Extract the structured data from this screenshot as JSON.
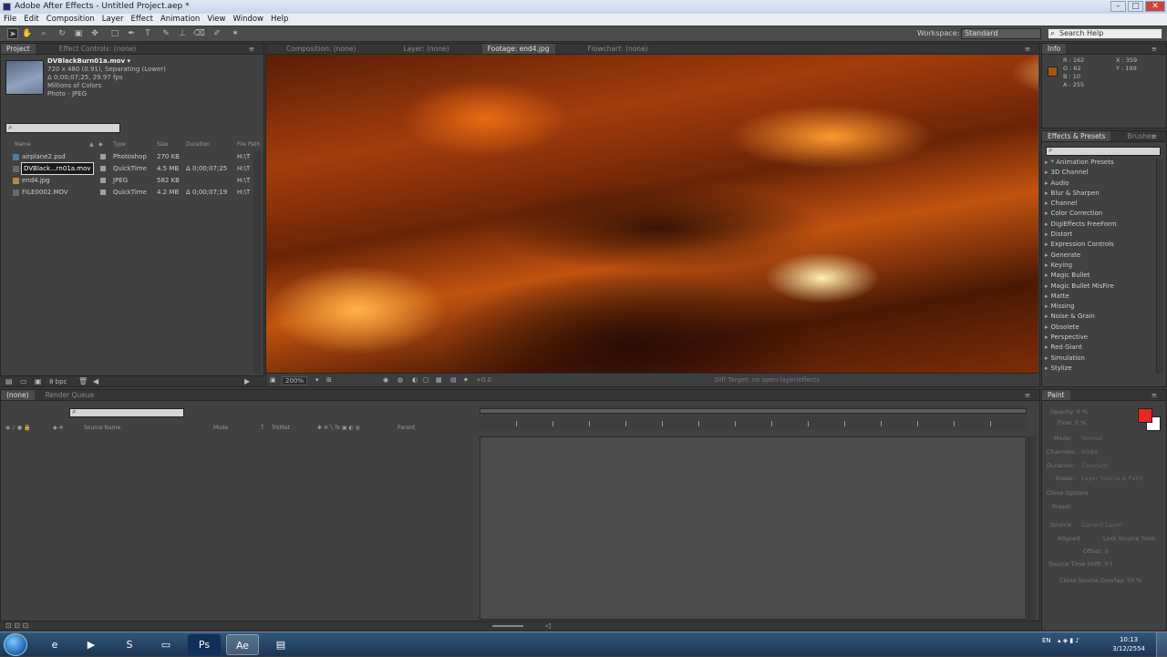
{
  "window": {
    "title": "Adobe After Effects - Untitled Project.aep *",
    "min": "–",
    "max": "□",
    "close": "✕"
  },
  "menu": [
    "File",
    "Edit",
    "Composition",
    "Layer",
    "Effect",
    "Animation",
    "View",
    "Window",
    "Help"
  ],
  "workspace": {
    "label": "Workspace:",
    "value": "Standard",
    "search_placeholder": "Search Help"
  },
  "project": {
    "tabs": [
      "Project",
      "Effect Controls: (none)"
    ],
    "preview": {
      "name": "DVBlackBurn01a.mov ▾",
      "line1": "720 x 480 (0.91), Separating (Lower)",
      "line2": "Δ 0;00;07;25, 29.97 fps",
      "line3": "Millions of Colors",
      "line4": "Photo - JPEG"
    },
    "columns": [
      "Name",
      "Type",
      "Size",
      "Duration",
      "File Path"
    ],
    "items": [
      {
        "name": "airplane2.psd",
        "type": "Photoshop",
        "size": "270 KB",
        "duration": "",
        "path": "H:\\T"
      },
      {
        "name": "DVBlack...rn01a.mov",
        "type": "QuickTime",
        "size": "4.5 MB",
        "duration": "Δ 0;00;07;25",
        "path": "H:\\T"
      },
      {
        "name": "end4.jpg",
        "type": "JPEG",
        "size": "582 KB",
        "duration": "",
        "path": "H:\\T"
      },
      {
        "name": "FILE0002.MOV",
        "type": "QuickTime",
        "size": "4.2 MB",
        "duration": "Δ 0;00;07;19",
        "path": "H:\\T"
      }
    ],
    "bpc": "8 bpc"
  },
  "viewer": {
    "tabs": [
      "Composition: (none)",
      "Layer: (none)",
      "Footage: end4.jpg",
      "Flowchart: (none)"
    ],
    "zoom": "200%",
    "offset": "+0.0",
    "status": "Diff Target: no open-layer/effects"
  },
  "info": {
    "tab": "Info",
    "r": "R : 162",
    "g": "G : 62",
    "b": "B : 10",
    "a": "A : 255",
    "x": "X : 359",
    "y": "Y : 199",
    "swatch": "#a25a10"
  },
  "effects": {
    "tabs": [
      "Effects & Presets",
      "Brushes"
    ],
    "items": [
      "* Animation Presets",
      "3D Channel",
      "Audio",
      "Blur & Sharpen",
      "Channel",
      "Color Correction",
      "DigiEffects FreeForm",
      "Distort",
      "Expression Controls",
      "Generate",
      "Keying",
      "Magic Bullet",
      "Magic Bullet MisFire",
      "Matte",
      "Missing",
      "Noise & Grain",
      "Obsolete",
      "Perspective",
      "Red Giant",
      "Simulation",
      "Stylize"
    ]
  },
  "timeline": {
    "tabs": [
      "(none)",
      "Render Queue"
    ],
    "columns": [
      "Source Name",
      "Mode",
      "T",
      "TrkMat",
      "Parent"
    ]
  },
  "paint": {
    "tab": "Paint",
    "fg": "#e8271e",
    "bg": "#ffffff",
    "labels": [
      "Opacity: 0 %",
      "Flow: 0 %",
      "Mode:",
      "Normal",
      "Channels:",
      "RGBA",
      "Duration:",
      "Constant",
      "Erase:",
      "Layer Source & Paint",
      "Clone Options",
      "Preset:",
      "Source:",
      "Current Layer",
      "Aligned",
      "Lock Source Time",
      "Offset: 0",
      "Source Time Shift: 0 f",
      "Clone Source Overlay: 50 %"
    ]
  },
  "taskbar": {
    "time": "10:13",
    "date": "3/12/2554",
    "lang": "EN"
  }
}
